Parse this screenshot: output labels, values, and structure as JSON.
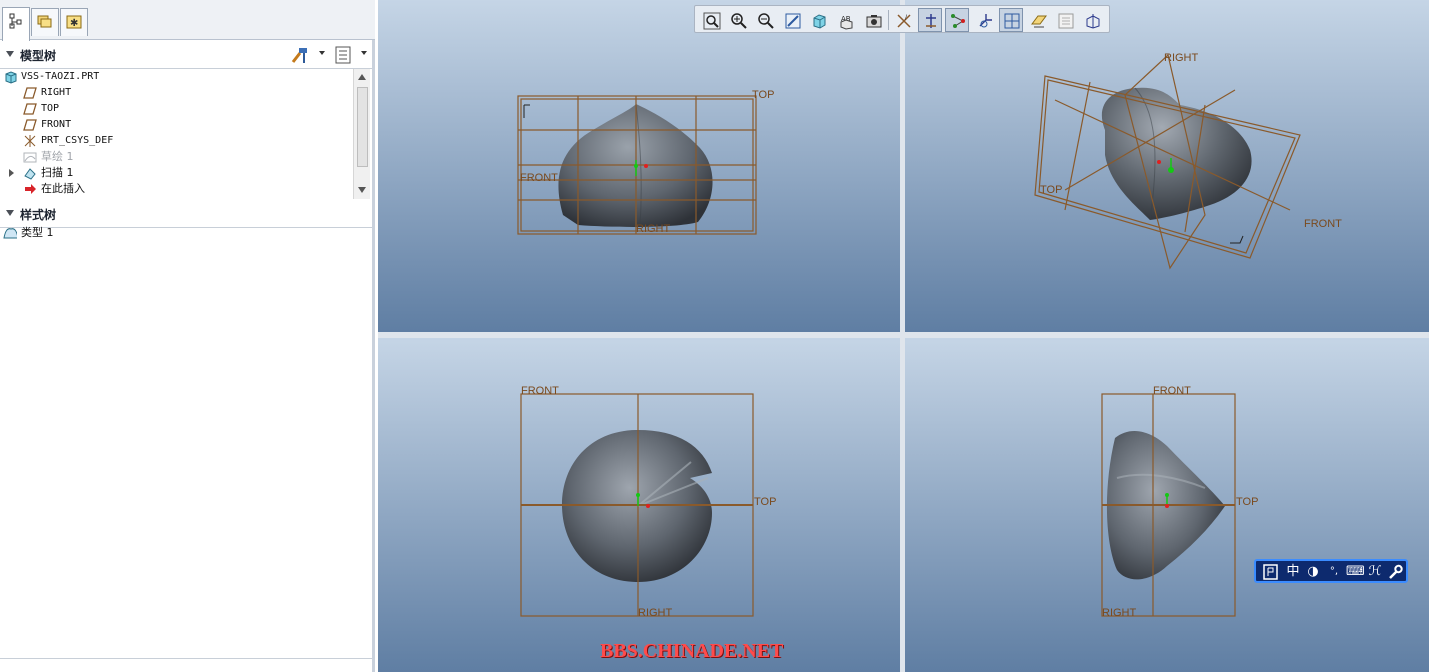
{
  "navigator": {
    "tabs": [
      {
        "name": "model-tree-tab",
        "icon": "tree-structure-icon",
        "active": true
      },
      {
        "name": "folder-browser-tab",
        "icon": "folders-icon",
        "active": false
      },
      {
        "name": "favorites-tab",
        "icon": "favorites-icon",
        "active": false
      }
    ],
    "model_tree": {
      "title": "模型树",
      "items": [
        {
          "label": "VSS-TAOZI.PRT",
          "icon": "part-icon",
          "dim": false
        },
        {
          "label": "RIGHT",
          "icon": "datum-plane-icon",
          "dim": false
        },
        {
          "label": "TOP",
          "icon": "datum-plane-icon",
          "dim": false
        },
        {
          "label": "FRONT",
          "icon": "datum-plane-icon",
          "dim": false
        },
        {
          "label": "PRT_CSYS_DEF",
          "icon": "csys-icon",
          "dim": false
        },
        {
          "label": "草绘 1",
          "icon": "sketch-icon",
          "dim": true
        },
        {
          "label": "扫描 1",
          "icon": "sweep-icon",
          "dim": false
        },
        {
          "label": "在此插入",
          "icon": "insert-here-arrow-icon",
          "dim": false
        }
      ]
    },
    "style_tree": {
      "title": "样式树",
      "items": [
        {
          "label": "类型 1",
          "icon": "style-type-icon"
        }
      ]
    }
  },
  "toolbar": {
    "buttons": [
      {
        "name": "refit-button",
        "icon": "refit-icon",
        "on": false
      },
      {
        "name": "zoom-in-button",
        "icon": "zoom-in-icon",
        "on": false
      },
      {
        "name": "zoom-out-button",
        "icon": "zoom-out-icon",
        "on": false
      },
      {
        "name": "repaint-button",
        "icon": "repaint-icon",
        "on": false
      },
      {
        "name": "display-style-button",
        "icon": "shaded-cube-icon",
        "on": false
      },
      {
        "name": "saved-views-button",
        "icon": "saved-views-icon",
        "on": false
      },
      {
        "name": "view-manager-button",
        "icon": "view-manager-icon",
        "on": false
      },
      {
        "name": "datum-planes-button",
        "icon": "datum-planes-display-icon",
        "on": false
      },
      {
        "name": "datum-axes-button",
        "icon": "datum-axes-display-icon",
        "on": true
      },
      {
        "name": "datum-points-button",
        "icon": "datum-points-display-icon",
        "on": true
      },
      {
        "name": "csys-display-button",
        "icon": "csys-display-icon",
        "on": false
      },
      {
        "name": "spin-center-button",
        "icon": "spin-center-icon",
        "on": true
      },
      {
        "name": "annotation-display-button",
        "icon": "annotation-display-icon",
        "on": false
      },
      {
        "name": "layers-button",
        "icon": "layers-icon",
        "on": false
      },
      {
        "name": "perspective-button",
        "icon": "perspective-icon",
        "on": false
      }
    ]
  },
  "viewports": [
    {
      "name": "viewport-front",
      "labels": [
        "TOP",
        "FRONT",
        "RIGHT"
      ]
    },
    {
      "name": "viewport-isometric",
      "labels": [
        "RIGHT",
        "TOP",
        "FRONT"
      ]
    },
    {
      "name": "viewport-top",
      "labels": [
        "FRONT",
        "TOP",
        "RIGHT"
      ]
    },
    {
      "name": "viewport-right",
      "labels": [
        "FRONT",
        "TOP",
        "RIGHT"
      ]
    }
  ],
  "ime_bar": {
    "items": [
      "中",
      "◑",
      "°,",
      "⌨",
      "ℋ",
      "🔧"
    ]
  },
  "watermark": "BBS.CHINADE.NET",
  "colors": {
    "datum": "#8a5a2b",
    "background_top": "#c5d5e6",
    "background_bottom": "#5f7ea3",
    "ime_bg": "#0d2a6e"
  }
}
